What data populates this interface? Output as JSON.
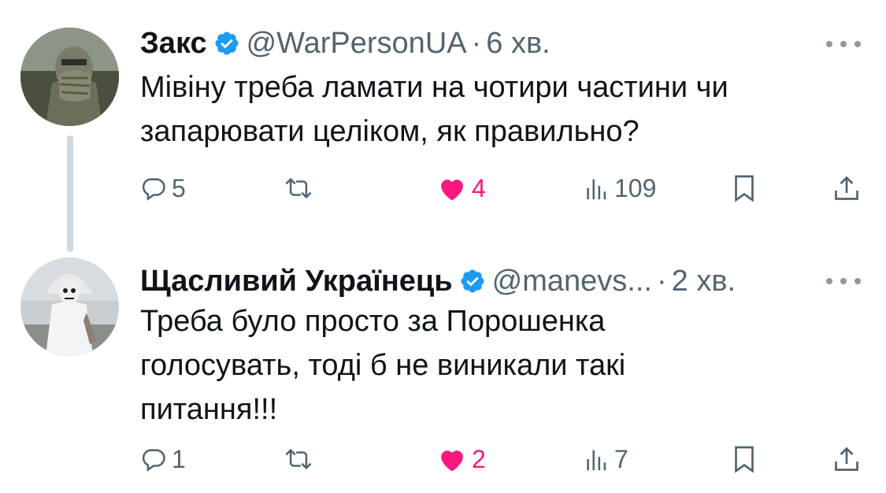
{
  "tweets": [
    {
      "name": "Закс",
      "handle": "@WarPersonUA",
      "separator": "·",
      "time": "6 хв.",
      "text_lines": [
        "Мівіну треба ламати на чотири частини чи",
        "запарювати целіком, як правильно?"
      ],
      "replies": "5",
      "likes": "4",
      "views": "109",
      "liked": true
    },
    {
      "name": "Щасливий Українець",
      "handle": "@manevs...",
      "separator": "·",
      "time": "2 хв.",
      "text_lines": [
        "Треба було просто за Порошенка",
        "голосувать, тоді б не виникали такі",
        "питання!!!"
      ],
      "replies": "1",
      "likes": "2",
      "views": "7",
      "liked": true
    }
  ],
  "colors": {
    "verified": "#1d9bf0",
    "like": "#f91880",
    "secondary_text": "#536471",
    "thread_line": "#cfd9de"
  },
  "icons": [
    "verified-badge-icon",
    "more-icon",
    "reply-icon",
    "retweet-icon",
    "heart-icon",
    "views-icon",
    "bookmark-icon",
    "share-icon"
  ]
}
